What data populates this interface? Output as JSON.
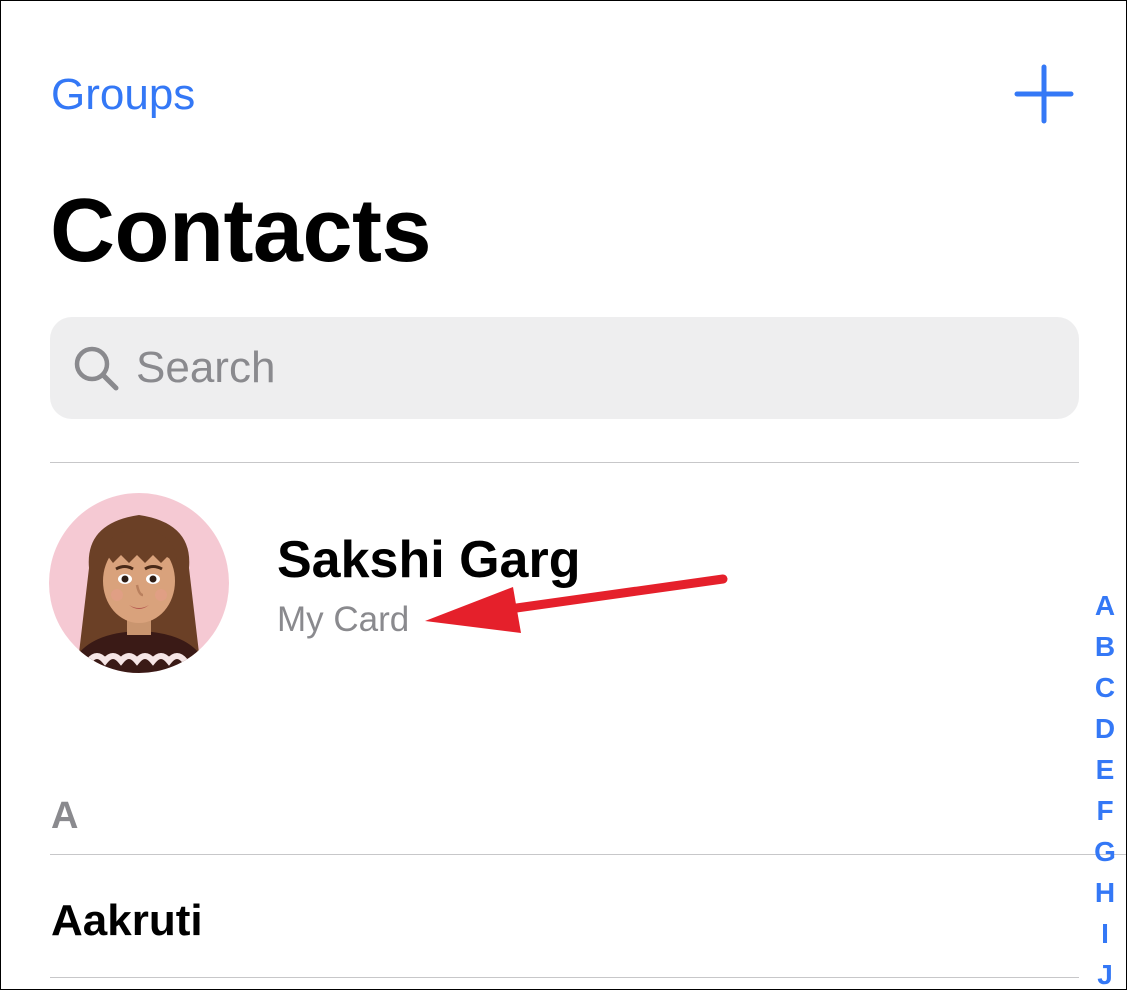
{
  "colors": {
    "accent": "#3478f6",
    "annotation": "#e5202b"
  },
  "nav": {
    "groups_label": "Groups",
    "add_icon": "plus-icon"
  },
  "header": {
    "title": "Contacts"
  },
  "search": {
    "icon": "search-icon",
    "placeholder": "Search"
  },
  "my_card": {
    "name": "Sakshi Garg",
    "subtitle": "My Card",
    "avatar": "memoji-avatar"
  },
  "annotation": {
    "icon": "red-arrow-pointer"
  },
  "sections": [
    {
      "header": "A",
      "contacts": [
        "Aakruti"
      ]
    }
  ],
  "index": [
    "A",
    "B",
    "C",
    "D",
    "E",
    "F",
    "G",
    "H",
    "I",
    "J"
  ]
}
